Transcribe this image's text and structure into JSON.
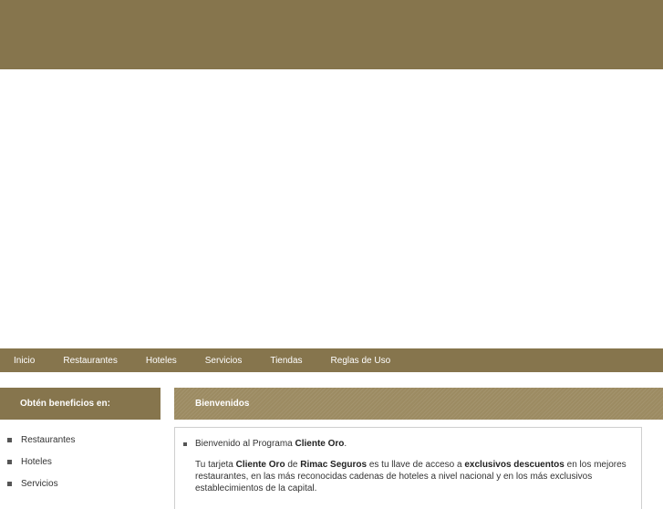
{
  "navbar": {
    "items": [
      {
        "label": "Inicio"
      },
      {
        "label": "Restaurantes"
      },
      {
        "label": "Hoteles"
      },
      {
        "label": "Servicios"
      },
      {
        "label": "Tiendas"
      },
      {
        "label": "Reglas de Uso"
      }
    ]
  },
  "sidebar": {
    "title": "Obtén beneficios en:",
    "items": [
      {
        "label": "Restaurantes"
      },
      {
        "label": "Hoteles"
      },
      {
        "label": "Servicios"
      }
    ]
  },
  "main": {
    "title": "Bienvenidos",
    "welcome_prefix": "Bienvenido al Programa ",
    "welcome_program": "Cliente Oro",
    "welcome_suffix": ".",
    "p_part1": "Tu tarjeta ",
    "p_card": "Cliente Oro",
    "p_part2": " de ",
    "p_company": "Rimac Seguros",
    "p_part3": " es tu llave de acceso a ",
    "p_discounts": "exclusivos descuentos",
    "p_part4": " en los mejores restaurantes, en las más reconocidas cadenas de hoteles a nivel nacional y en los más exclusivos establecimientos de la capital."
  },
  "colors": {
    "brand": "#86754d",
    "header_accent": "#9c8b62"
  }
}
